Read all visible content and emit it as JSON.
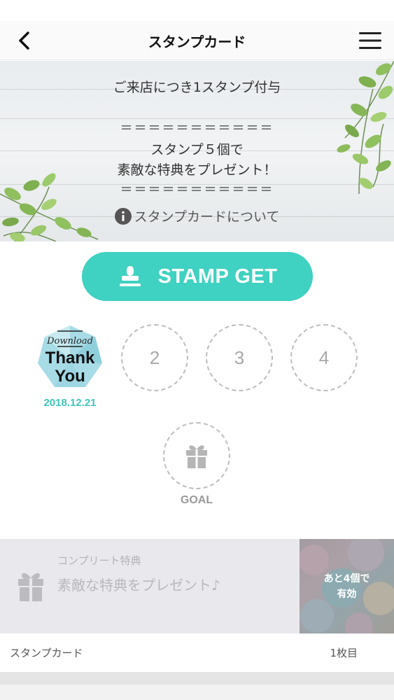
{
  "header": {
    "title": "スタンプカード",
    "back_icon": "chevron-left-icon",
    "menu_icon": "hamburger-menu-icon"
  },
  "banner": {
    "line1": "ご来店につき1スタンプ付与",
    "divider_top": "＝＝＝＝＝＝＝＝＝＝＝",
    "line2": "スタンプ５個で",
    "line3": "素敵な特典をプレゼント！",
    "divider_bottom": "＝＝＝＝＝＝＝＝＝＝＝",
    "info_link": "スタンプカードについて",
    "info_icon": "info-circle-icon"
  },
  "stamp_button": {
    "label": "STAMP GET",
    "icon": "stamp-icon",
    "color": "#3fd1c1"
  },
  "stamps": {
    "first": {
      "image_text_top": "Download",
      "image_text_mid": "Thank",
      "image_text_bottom": "You",
      "date": "2018.12.21"
    },
    "slots": [
      "2",
      "3",
      "4"
    ],
    "goal_label": "GOAL",
    "goal_icon": "gift-icon"
  },
  "complete_reward": {
    "title": "コンプリート特典",
    "description": "素敵な特典をプレゼント♪",
    "icon": "gift-icon",
    "remaining_line1": "あと4個で",
    "remaining_line2": "有効"
  },
  "footer": {
    "label": "スタンプカード",
    "card_count": "1枚目"
  }
}
